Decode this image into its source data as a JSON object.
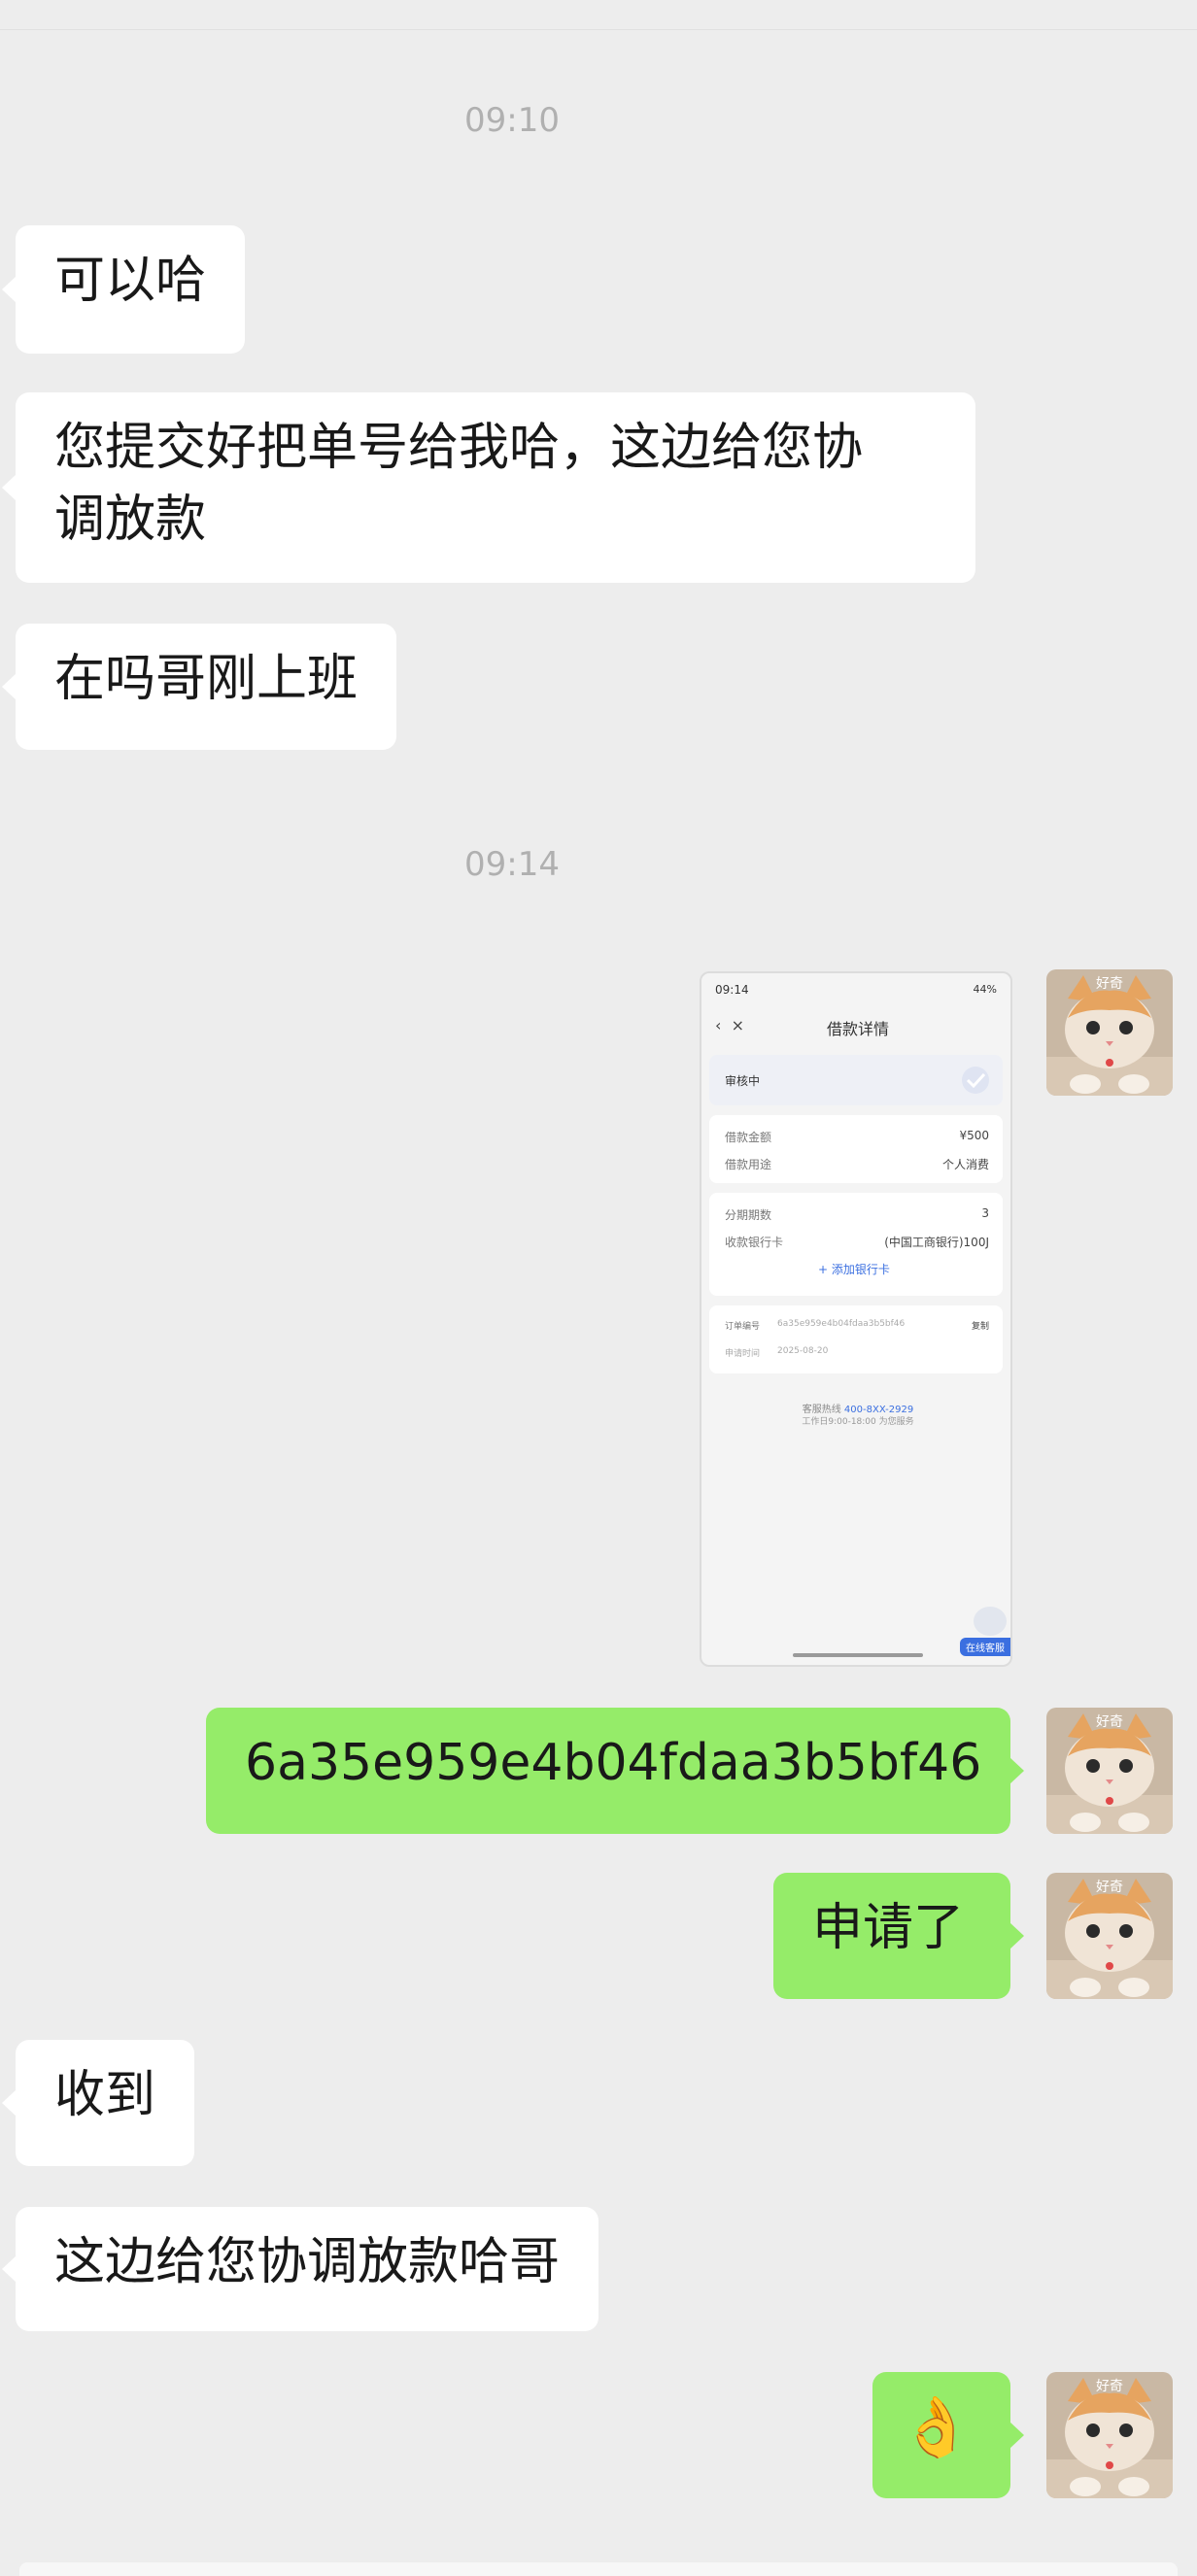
{
  "header": {
    "partial_title": ""
  },
  "timestamps": [
    "09:10",
    "09:14"
  ],
  "messages": {
    "m1": "可以哈",
    "m2_line1": "您提交好把单号给我哈，这边给您协",
    "m2_line2": "调放款",
    "m3": "在吗哥刚上班",
    "m4": "6a35e959e4b04fdaa3b5bf46",
    "m5": "申请了",
    "m6": "收到",
    "m7": "这边给您协调放款哈哥",
    "m8": "👌"
  },
  "avatar": {
    "badge": "好奇"
  },
  "screenshot": {
    "status_time": "09:14",
    "status_right": "44%",
    "back_icon": "chevron-left-icon",
    "close_icon": "close-icon",
    "title": "借款详情",
    "status": "审核中",
    "amount_label": "借款金额",
    "amount_value": "¥500",
    "purpose_label": "借款用途",
    "purpose_value": "个人消费",
    "term_label": "分期期数",
    "term_value": "3",
    "card_label": "收款银行卡",
    "card_value": "(中国工商银行)100J",
    "add_card": "+ 添加银行卡",
    "order_label": "订单编号",
    "order_value": "6a35e959e4b04fdaa3b5bf46",
    "copy": "复制",
    "date_label": "申请时间",
    "date_value": "2025-08-20",
    "hotline_label": "客服热线",
    "hotline_value": "400-8XX-2929",
    "hotline_note": "工作日9:00-18:00 为您服务",
    "service_badge": "在线客服"
  },
  "colors": {
    "background": "#ededed",
    "incoming_bubble": "#ffffff",
    "outgoing_bubble": "#95ec69",
    "timestamp": "#b0b0b0"
  }
}
